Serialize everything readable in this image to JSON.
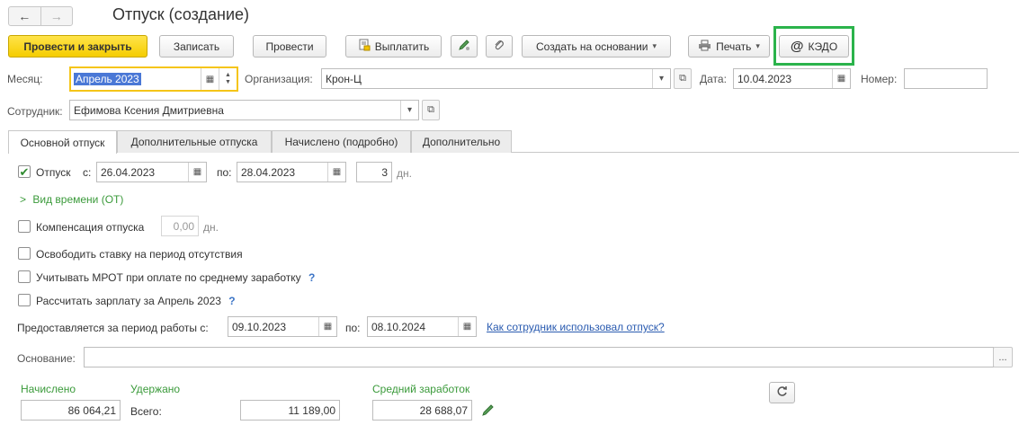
{
  "window": {
    "title": "Отпуск (создание)",
    "back_icon": "←",
    "forward_icon": "→"
  },
  "toolbar": {
    "post_and_close": "Провести и закрыть",
    "save": "Записать",
    "post": "Провести",
    "pay": "Выплатить",
    "create_based_on": "Создать на основании",
    "print": "Печать",
    "kedo": "КЭДО"
  },
  "header": {
    "month_label": "Месяц:",
    "month_value": "Апрель 2023",
    "org_label": "Организация:",
    "org_value": "Крон-Ц",
    "date_label": "Дата:",
    "date_value": "10.04.2023",
    "number_label": "Номер:",
    "number_value": "",
    "employee_label": "Сотрудник:",
    "employee_value": "Ефимова Ксения Дмитриевна"
  },
  "tabs": [
    {
      "label": "Основной отпуск"
    },
    {
      "label": "Дополнительные отпуска"
    },
    {
      "label": "Начислено (подробно)"
    },
    {
      "label": "Дополнительно"
    }
  ],
  "main": {
    "vacation_label": "Отпуск",
    "from_label": "с:",
    "from_value": "26.04.2023",
    "to_label": "по:",
    "to_value": "28.04.2023",
    "days_value": "3",
    "days_unit": "дн.",
    "time_type_label": "Вид времени (ОТ)",
    "compensation_label": "Компенсация отпуска",
    "compensation_value": "0,00",
    "compensation_unit": "дн.",
    "release_rate_label": "Освободить ставку на период отсутствия",
    "mrot_label": "Учитывать МРОТ при оплате по среднему заработку",
    "calc_salary_label": "Рассчитать зарплату за Апрель 2023",
    "help_mark": "?",
    "period_label": "Предоставляется за период работы с:",
    "period_from": "09.10.2023",
    "period_to_label": "по:",
    "period_to": "08.10.2024",
    "usage_link": "Как сотрудник использовал отпуск?",
    "basis_label": "Основание:",
    "basis_value": "",
    "basis_btn": "..."
  },
  "totals": {
    "accrued_label": "Начислено",
    "accrued_value": "86 064,21",
    "withheld_label": "Удержано",
    "total_label": "Всего:",
    "withheld_value": "11 189,00",
    "avg_label": "Средний заработок",
    "avg_value": "28 688,07"
  },
  "colors": {
    "primary_button": "#f5cd00",
    "kedo_highlight": "#2bb34b",
    "month_focus": "#f5c518",
    "selection": "#4a78d6",
    "section_green": "#3a9a3a",
    "link": "#2a5bb0"
  }
}
